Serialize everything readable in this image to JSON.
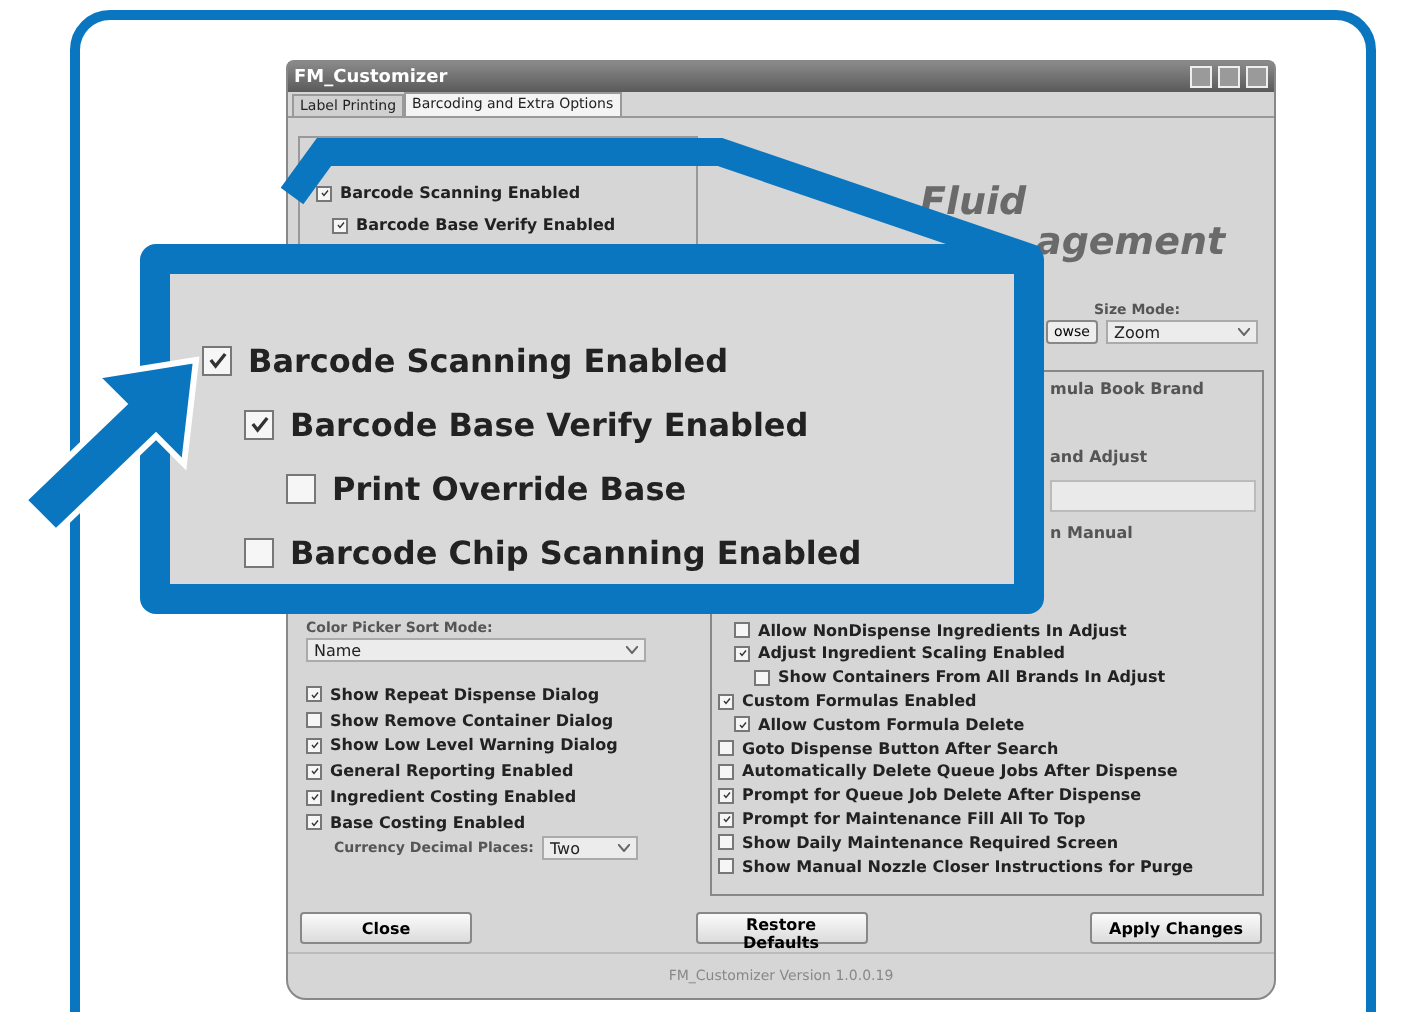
{
  "window": {
    "title": "FM_Customizer"
  },
  "tabs": [
    {
      "label": "Label Printing",
      "selected": false
    },
    {
      "label": "Barcoding and Extra Options",
      "selected": true
    }
  ],
  "barcode_options": [
    {
      "label": "Barcode Scanning Enabled",
      "checked": true
    },
    {
      "label": "Barcode Base Verify Enabled",
      "checked": true
    }
  ],
  "logo": {
    "line_1": "Fluid",
    "line_2": "agement"
  },
  "size_mode": {
    "label": "Size Mode:",
    "browse_button": "owse",
    "value": "Zoom"
  },
  "brand_panel": {
    "texts": [
      "mula Book Brand",
      "and Adjust",
      "n Manual"
    ]
  },
  "color_picker": {
    "label": "Color Picker Sort Mode:",
    "value": "Name"
  },
  "left_options": [
    {
      "label": "Show Repeat Dispense Dialog",
      "checked": true
    },
    {
      "label": "Show Remove Container Dialog",
      "checked": false
    },
    {
      "label": "Show Low Level Warning Dialog",
      "checked": true
    },
    {
      "label": "General Reporting Enabled",
      "checked": true
    },
    {
      "label": "Ingredient Costing Enabled",
      "checked": true
    },
    {
      "label": "Base Costing Enabled",
      "checked": true
    }
  ],
  "currency": {
    "label": "Currency Decimal Places:",
    "value": "Two"
  },
  "adjust_options": [
    {
      "label": "Allow NonDispense Ingredients In Adjust",
      "checked": false
    },
    {
      "label": "Adjust Ingredient Scaling Enabled",
      "checked": true,
      "children": [
        {
          "label": "Show Containers From All Brands In Adjust",
          "checked": false
        }
      ]
    }
  ],
  "right_options": [
    {
      "label": "Custom Formulas Enabled",
      "checked": true,
      "children": [
        {
          "label": "Allow Custom Formula Delete",
          "checked": true
        }
      ]
    },
    {
      "label": "Goto Dispense Button After Search",
      "checked": false
    },
    {
      "label": "Automatically Delete Queue Jobs After Dispense",
      "checked": false
    },
    {
      "label": "Prompt for Queue Job Delete After Dispense",
      "checked": true
    },
    {
      "label": "Prompt for Maintenance Fill All To Top",
      "checked": true
    },
    {
      "label": "Show Daily Maintenance Required Screen",
      "checked": false
    },
    {
      "label": "Show Manual Nozzle Closer Instructions for Purge",
      "checked": false
    }
  ],
  "buttons": [
    "Close",
    "Restore Defaults",
    "Apply Changes"
  ],
  "version": "FM_Customizer Version 1.0.0.19",
  "callout": {
    "options": [
      {
        "label": "Barcode Scanning Enabled",
        "checked": true,
        "children": [
          {
            "label": "Barcode Base Verify Enabled",
            "checked": true,
            "children": [
              {
                "label": "Print Override Base",
                "checked": false
              }
            ]
          },
          {
            "label": "Barcode Chip Scanning Enabled",
            "checked": false
          }
        ]
      }
    ]
  }
}
